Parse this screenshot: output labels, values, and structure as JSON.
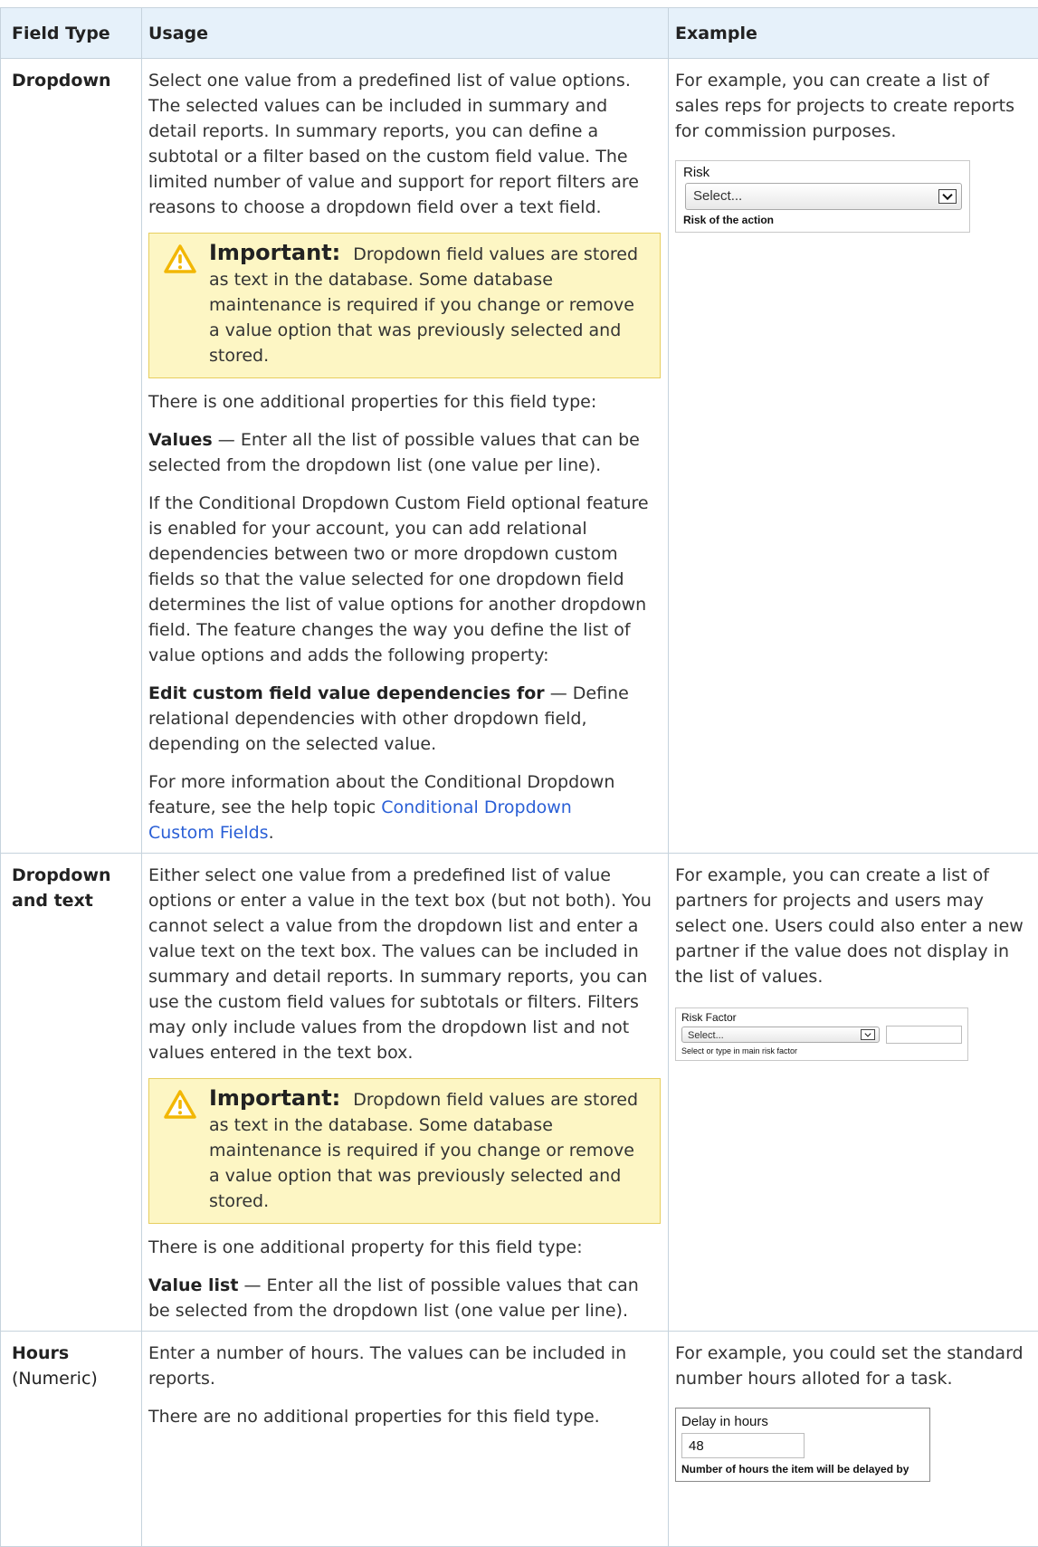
{
  "headers": {
    "field_type": "Field Type",
    "usage": "Usage",
    "example": "Example"
  },
  "rows": [
    {
      "name": "Dropdown",
      "usage": {
        "intro": "Select one value from a predefined list of value options. The selected values can be included in summary and detail reports. In summary reports, you can define a subtotal or a filter based on the custom field value. The limited number of value and support for report filters are reasons to choose a dropdown field over a text field.",
        "important_label": "Important:",
        "important_text": "Dropdown field values are stored as text in the database. Some database maintenance is required if you change or remove a value option that was previously selected and stored.",
        "props_intro": "There is one additional properties for this field type:",
        "prop1_name": "Values",
        "prop1_text": " — Enter all the list of possible values that can be selected from the dropdown list (one value per line).",
        "conditional": "If the Conditional Dropdown Custom Field optional feature is enabled for your account, you can add relational dependencies between two or more dropdown custom fields so that the value selected for one dropdown field determines the list of value options for another dropdown field. The feature changes the way you define the list of value options and adds the following property:",
        "prop2_name": "Edit custom field value dependencies for",
        "prop2_text": " — Define relational dependencies with other dropdown field, depending on the selected value.",
        "more_info": "For more information about the Conditional Dropdown feature, see the help topic ",
        "link": "Conditional Dropdown Custom Fields",
        "more_info_end": "."
      },
      "example": {
        "text": "For example, you can create a list of sales reps for projects to create reports for commission purposes.",
        "widget_label": "Risk",
        "widget_select": "Select...",
        "widget_help": "Risk of the action"
      }
    },
    {
      "name": "Dropdown and text",
      "usage": {
        "intro": "Either select one value from a predefined list of value options or enter a value in the text box (but not both). You cannot select a value from the dropdown list and enter a value text on the text box. The values can be included in summary and detail reports. In summary reports, you can use the custom field values for subtotals or filters. Filters may only include values from the dropdown list and not values entered in the text box.",
        "important_label": "Important:",
        "important_text": "Dropdown field values are stored as text in the database. Some database maintenance is required if you change or remove a value option that was previously selected and stored.",
        "props_intro": "There is one additional property for this field type:",
        "prop1_name": "Value list",
        "prop1_text": " — Enter all the list of possible values that can be selected from the dropdown list (one value per line)."
      },
      "example": {
        "text": "For example, you can create a list of partners for projects and users may select one. Users could also enter a new partner if the value does not display in the list of values.",
        "widget_label": "Risk Factor",
        "widget_select": "Select...",
        "widget_help": "Select or type in main risk factor"
      }
    },
    {
      "name": "Hours",
      "subtitle": "(Numeric)",
      "usage": {
        "intro": "Enter a number of hours. The values can be included in reports.",
        "props_intro": "There are no additional properties for this field type."
      },
      "example": {
        "text": "For example, you could set the standard number hours alloted for a task.",
        "widget_label": "Delay in hours",
        "widget_value": "48",
        "widget_help": "Number of hours the item will be delayed by"
      }
    }
  ],
  "colors": {
    "header_bg": "#e6f1fa",
    "border": "#c6d3dd",
    "important_bg": "#fdf6c4",
    "important_border": "#e7ce5f",
    "warning_icon": "#f2b705",
    "link": "#2a5fd6"
  },
  "icons": {
    "important": "warning-triangle-icon",
    "dropdown": "chevron-down-icon"
  }
}
